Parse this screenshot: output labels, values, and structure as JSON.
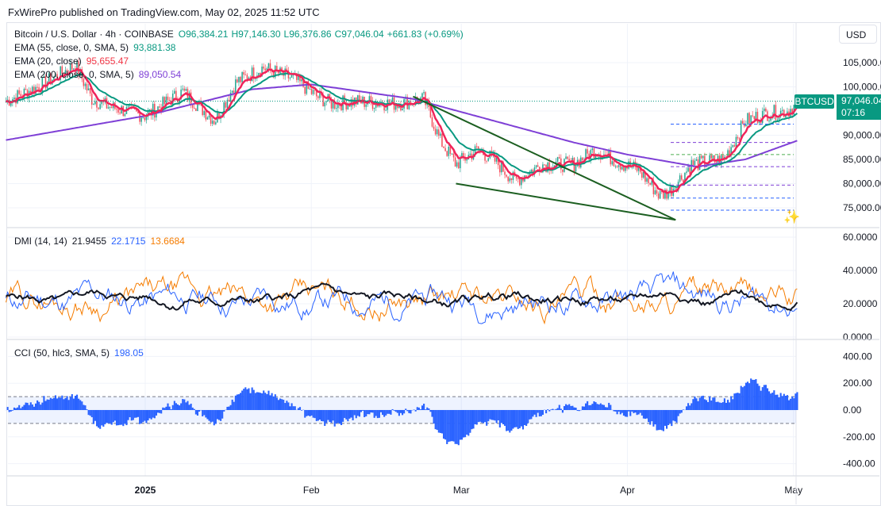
{
  "header": {
    "published": "FxWirePro published on TradingView.com, May 02, 2025 11:52 UTC",
    "currency": "USD"
  },
  "legend": {
    "symbol": "Bitcoin / U.S. Dollar · 4h · COINBASE",
    "open": "O96,384.21",
    "high": "H97,146.30",
    "low": "L96,376.86",
    "close": "C97,046.04",
    "change": "+661.83 (+0.69%)",
    "ema55_label": "EMA (55, close, 0, SMA, 5)",
    "ema55_value": "93,881.38",
    "ema20_label": "EMA (20, close)",
    "ema20_value": "95,655.47",
    "ema200_label": "EMA (200, close, 0, SMA, 5)",
    "ema200_value": "89,050.54",
    "dmi_label": "DMI (14, 14)",
    "dmi_adx": "21.9455",
    "dmi_plus": "22.1715",
    "dmi_minus": "13.6684",
    "cci_label": "CCI (50, hlc3, SMA, 5)",
    "cci_value": "198.05"
  },
  "price_badge": {
    "symbol": "BTCUSD",
    "price": "97,046.04",
    "countdown": "07:16"
  },
  "colors": {
    "up": "#089981",
    "down": "#f23645",
    "ema20": "#f0245a",
    "ema55": "#089981",
    "ema200": "#7e3fd6",
    "adx": "#131722",
    "plus": "#2962ff",
    "minus": "#f57c00",
    "cci": "#2962ff"
  },
  "chart_data": [
    {
      "type": "candlestick",
      "title": "Bitcoin / U.S. Dollar · 4h · COINBASE",
      "x_unit": "days from 2025-01-01",
      "x_ticks": [
        {
          "label": "2025",
          "d": 0
        },
        {
          "label": "Feb",
          "d": 31
        },
        {
          "label": "Mar",
          "d": 59
        },
        {
          "label": "Apr",
          "d": 90
        },
        {
          "label": "May",
          "d": 121
        }
      ],
      "y_ticks": [
        "105,000.00",
        "100,000.00",
        "95,000.00",
        "90,000.00",
        "85,000.00",
        "80,000.00",
        "75,000.00"
      ],
      "y_tick_values": [
        105000,
        100000,
        95000,
        90000,
        85000,
        80000,
        75000
      ],
      "ylim": [
        70000,
        110000
      ],
      "close_path": [
        [
          -26,
          97000
        ],
        [
          -20,
          100000
        ],
        [
          -13,
          104500
        ],
        [
          -10,
          97500
        ],
        [
          -7,
          96000
        ],
        [
          0,
          94000
        ],
        [
          7,
          99000
        ],
        [
          10,
          96000
        ],
        [
          13,
          93000
        ],
        [
          17,
          101000
        ],
        [
          22,
          104000
        ],
        [
          28,
          101500
        ],
        [
          32,
          98000
        ],
        [
          35,
          96500
        ],
        [
          39,
          97000
        ],
        [
          47,
          96500
        ],
        [
          52,
          97500
        ],
        [
          55,
          89000
        ],
        [
          58,
          84000
        ],
        [
          62,
          87000
        ],
        [
          65,
          85000
        ],
        [
          69,
          80500
        ],
        [
          74,
          84000
        ],
        [
          80,
          84000
        ],
        [
          84,
          87000
        ],
        [
          89,
          84000
        ],
        [
          92,
          83000
        ],
        [
          96,
          77500
        ],
        [
          98,
          78500
        ],
        [
          102,
          84000
        ],
        [
          108,
          85000
        ],
        [
          112,
          93000
        ],
        [
          116,
          94500
        ],
        [
          120,
          95000
        ],
        [
          122,
          97000
        ]
      ],
      "ema200_path": [
        [
          -26,
          89000
        ],
        [
          0,
          94000
        ],
        [
          20,
          99500
        ],
        [
          31,
          100500
        ],
        [
          50,
          97500
        ],
        [
          65,
          93000
        ],
        [
          80,
          88500
        ],
        [
          90,
          86000
        ],
        [
          103,
          83500
        ],
        [
          112,
          85000
        ],
        [
          122,
          89000
        ]
      ],
      "trendlines": [
        {
          "from": [
            50,
            98000
          ],
          "to": [
            99,
            72500
          ]
        },
        {
          "from": [
            58,
            80000
          ],
          "to": [
            99,
            72500
          ]
        }
      ],
      "levels": [
        {
          "price": 92300,
          "color": "#2962ff"
        },
        {
          "price": 88500,
          "color": "#7e3fd6"
        },
        {
          "price": 86000,
          "color": "#4caf50"
        },
        {
          "price": 83500,
          "color": "#7e3fd6"
        },
        {
          "price": 79700,
          "color": "#7e3fd6"
        },
        {
          "price": 77000,
          "color": "#2962ff"
        },
        {
          "price": 74500,
          "color": "#2962ff"
        }
      ]
    },
    {
      "type": "line",
      "title": "DMI (14, 14)",
      "y_ticks": [
        "60.0000",
        "40.0000",
        "20.0000",
        "0.0000"
      ],
      "y_tick_values": [
        60,
        40,
        20,
        0
      ],
      "ylim": [
        0,
        60
      ],
      "series": [
        {
          "name": "ADX",
          "last": 21.9455
        },
        {
          "name": "+DI",
          "last": 22.1715
        },
        {
          "name": "-DI",
          "last": 13.6684
        }
      ]
    },
    {
      "type": "bar",
      "title": "CCI (50, hlc3, SMA, 5)",
      "y_ticks": [
        "400.00",
        "200.00",
        "0.00",
        "-200.00",
        "-400.00"
      ],
      "y_tick_values": [
        400,
        200,
        0,
        -200,
        -400
      ],
      "ylim": [
        -450,
        450
      ],
      "bands": [
        100,
        -100
      ],
      "last": 198.05
    }
  ]
}
